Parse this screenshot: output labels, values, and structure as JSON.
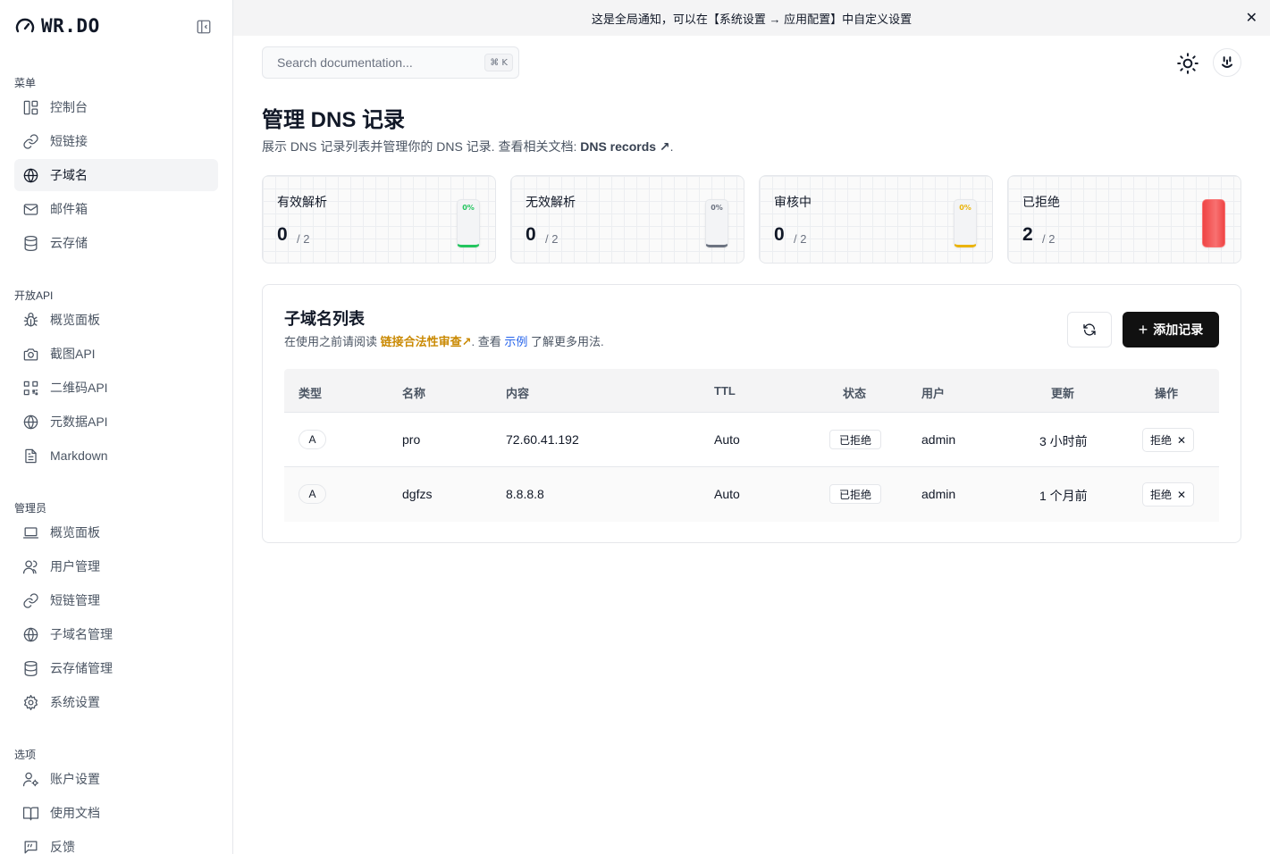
{
  "app": {
    "logo_text": "WR.DO"
  },
  "notice": {
    "text": "这是全局通知，可以在【系统设置 → 应用配置】中自定义设置"
  },
  "sidebar": {
    "sections": {
      "menu": "菜单",
      "open_api": "开放API",
      "admin": "管理员",
      "options": "选项"
    },
    "menu_items": [
      {
        "label": "控制台",
        "icon": "dashboard-icon"
      },
      {
        "label": "短链接",
        "icon": "link-icon"
      },
      {
        "label": "子域名",
        "icon": "globe-icon",
        "active": true
      },
      {
        "label": "邮件箱",
        "icon": "mail-icon"
      },
      {
        "label": "云存储",
        "icon": "database-icon"
      }
    ],
    "api_items": [
      {
        "label": "概览面板",
        "icon": "bug-icon"
      },
      {
        "label": "截图API",
        "icon": "camera-icon"
      },
      {
        "label": "二维码API",
        "icon": "qrcode-icon"
      },
      {
        "label": "元数据API",
        "icon": "globe-icon"
      },
      {
        "label": "Markdown",
        "icon": "file-text-icon"
      }
    ],
    "admin_items": [
      {
        "label": "概览面板",
        "icon": "laptop-icon"
      },
      {
        "label": "用户管理",
        "icon": "users-icon"
      },
      {
        "label": "短链管理",
        "icon": "link-icon"
      },
      {
        "label": "子域名管理",
        "icon": "globe-icon"
      },
      {
        "label": "云存储管理",
        "icon": "database-icon"
      },
      {
        "label": "系统设置",
        "icon": "gear-icon"
      }
    ],
    "option_items": [
      {
        "label": "账户设置",
        "icon": "user-cog-icon"
      },
      {
        "label": "使用文档",
        "icon": "book-icon"
      },
      {
        "label": "反馈",
        "icon": "message-icon"
      }
    ]
  },
  "header": {
    "search_placeholder": "Search documentation...",
    "search_shortcut": "⌘ K"
  },
  "page": {
    "title": "管理 DNS 记录",
    "desc_prefix": "展示 DNS 记录列表并管理你的 DNS 记录. 查看相关文档: ",
    "desc_link": "DNS records ↗",
    "desc_suffix": "."
  },
  "stats": [
    {
      "label": "有效解析",
      "value": "0",
      "total": "/ 2",
      "percent_label": "0%",
      "fraction": 0,
      "color": "#22c55e"
    },
    {
      "label": "无效解析",
      "value": "0",
      "total": "/ 2",
      "percent_label": "0%",
      "fraction": 0,
      "color": "#6b7280"
    },
    {
      "label": "审核中",
      "value": "0",
      "total": "/ 2",
      "percent_label": "0%",
      "fraction": 0,
      "color": "#eab308"
    },
    {
      "label": "已拒绝",
      "value": "2",
      "total": "/ 2",
      "percent_label": "",
      "fraction": 1,
      "color": "#ef4444"
    }
  ],
  "table": {
    "title": "子域名列表",
    "desc_prefix": "在使用之前请阅读 ",
    "desc_warn": "链接合法性审查↗",
    "desc_mid": ". 查看 ",
    "desc_link": "示例",
    "desc_suffix": " 了解更多用法.",
    "add_label": "添加记录",
    "headers": [
      "类型",
      "名称",
      "内容",
      "TTL",
      "状态",
      "用户",
      "更新",
      "操作"
    ],
    "rows": [
      {
        "type": "A",
        "name": "pro",
        "content": "72.60.41.192",
        "ttl": "Auto",
        "status": "已拒绝",
        "user": "admin",
        "updated": "3 小时前",
        "action": "拒绝"
      },
      {
        "type": "A",
        "name": "dgfzs",
        "content": "8.8.8.8",
        "ttl": "Auto",
        "status": "已拒绝",
        "user": "admin",
        "updated": "1 个月前",
        "action": "拒绝"
      }
    ]
  }
}
